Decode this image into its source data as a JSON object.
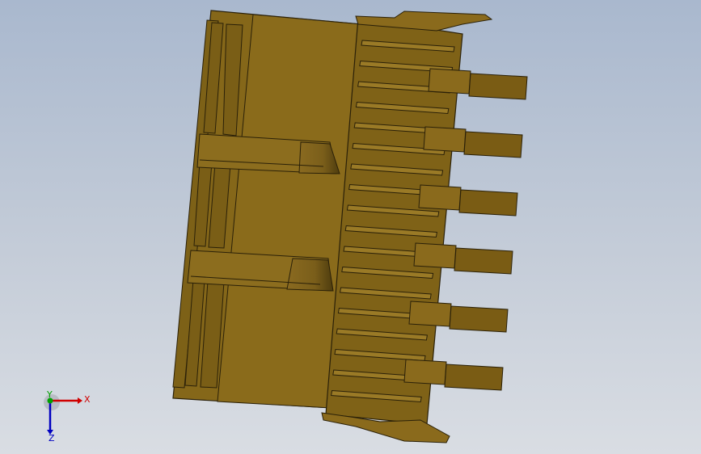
{
  "viewport": {
    "background_top": "#a9b8ce",
    "background_bottom": "#d9dde3"
  },
  "model": {
    "body_color": "#8a6a20",
    "body_dark": "#5e4812",
    "edge_color": "#2a2008",
    "pin_count": 6,
    "latch_count": 2
  },
  "triad": {
    "x_label": "X",
    "y_label": "Y",
    "z_label": "Z",
    "x_color": "#d00000",
    "y_color": "#00a000",
    "z_color": "#0000c0"
  }
}
